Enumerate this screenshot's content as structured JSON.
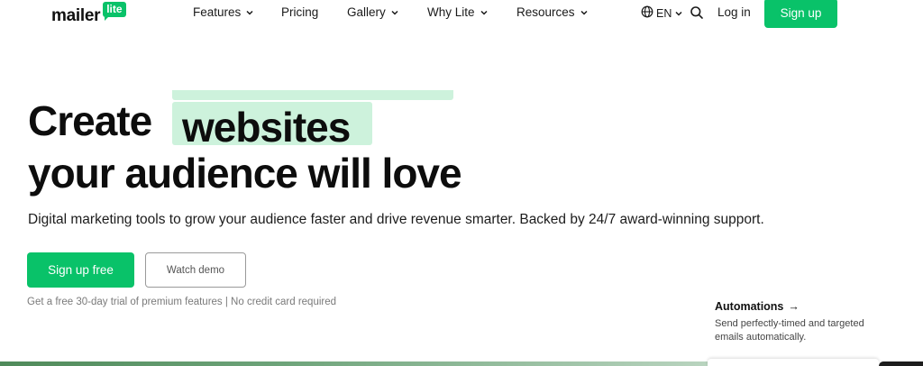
{
  "header": {
    "logo": {
      "word": "mailer",
      "badge": "lite"
    },
    "nav": [
      {
        "label": "Features",
        "has_dropdown": true
      },
      {
        "label": "Pricing",
        "has_dropdown": false
      },
      {
        "label": "Gallery",
        "has_dropdown": true
      },
      {
        "label": "Why Lite",
        "has_dropdown": true
      },
      {
        "label": "Resources",
        "has_dropdown": true
      }
    ],
    "language": {
      "icon": "globe-icon",
      "label": "EN"
    },
    "search_icon": "search-icon",
    "login_label": "Log in",
    "signup_label": "Sign up"
  },
  "hero": {
    "headline_word": "Create",
    "rotating_word": "websites",
    "headline_line2": "your audience will love",
    "subtext": "Digital marketing tools to grow your audience faster and drive revenue smarter. Backed by 24/7 award-winning support.",
    "primary_cta": "Sign up free",
    "secondary_cta": "Watch demo",
    "fineprint": "Get a free 30-day trial of premium features | No credit card required"
  },
  "feature_card": {
    "title": "Automations",
    "arrow": "→",
    "description": "Send perfectly-timed and targeted emails automatically."
  },
  "colors": {
    "brand_green": "#09c269",
    "highlight_green": "#cdf2dc",
    "text_dark": "#0d0d0d"
  }
}
